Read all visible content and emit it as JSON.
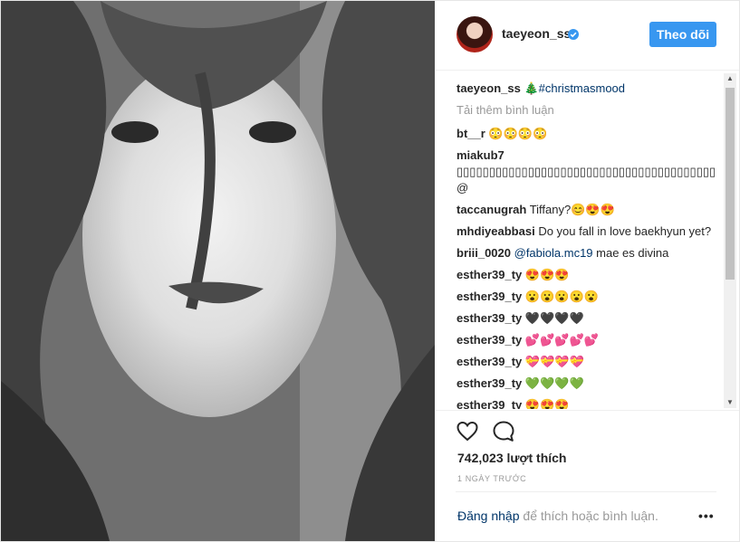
{
  "post": {
    "author": "taeyeon_ss",
    "follow_label": "Theo dõi"
  },
  "caption": {
    "user": "taeyeon_ss",
    "text": "🎄#christmasmood"
  },
  "load_more": "Tải thêm bình luận",
  "comments": [
    {
      "user": "bt__r",
      "text": "😳😳😳😳"
    },
    {
      "user": "miakub7",
      "text": "▯▯▯▯▯▯▯▯▯▯▯▯▯▯▯▯▯▯▯▯▯▯▯▯▯▯▯▯▯▯▯▯▯▯▯▯▯▯▯▯ @"
    },
    {
      "user": "taccanugrah",
      "text": "Tiffany?😊😍😍"
    },
    {
      "user": "mhdiyeabbasi",
      "text": "Do you fall in love baekhyun yet?"
    },
    {
      "user": "briii_0020",
      "mention": "@fabiola.mc19",
      "text": " mae es divina"
    },
    {
      "user": "esther39_ty",
      "text": "😍😍😍"
    },
    {
      "user": "esther39_ty",
      "text": "😮😮😮😮😮"
    },
    {
      "user": "esther39_ty",
      "text": "🖤🖤🖤🖤"
    },
    {
      "user": "esther39_ty",
      "text": "💕💕💕💕💕"
    },
    {
      "user": "esther39_ty",
      "text": "💝💝💝💝"
    },
    {
      "user": "esther39_ty",
      "text": "💚💚💚💚"
    },
    {
      "user": "esther39_ty",
      "text": "😍😍😍"
    }
  ],
  "likes": "742,023 lượt thích",
  "time": "1 NGÀY TRƯỚC",
  "login": {
    "link": "Đăng nhập",
    "rest": " để thích hoặc bình luận."
  },
  "more_label": "•••",
  "icons": {
    "like": "heart-icon",
    "comment": "comment-bubble-icon",
    "verified": "verified-badge-icon",
    "more": "more-options-icon"
  },
  "colors": {
    "follow_button": "#3897f0",
    "link": "#003569",
    "muted": "#999999"
  }
}
